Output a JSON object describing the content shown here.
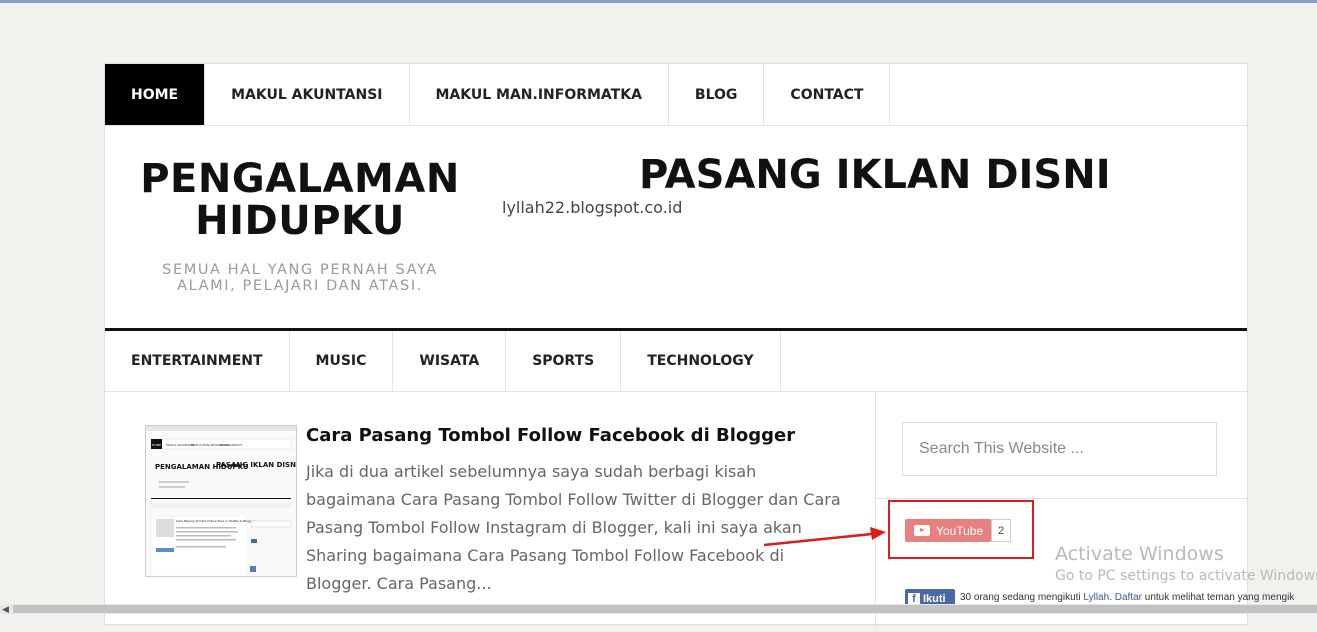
{
  "nav": {
    "items": [
      "HOME",
      "MAKUL AKUNTANSI",
      "MAKUL MAN.INFORMATKA",
      "BLOG",
      "CONTACT"
    ],
    "active": "HOME"
  },
  "header": {
    "site_title_line1": "PENGALAMAN",
    "site_title_line2": "HIDUPKU",
    "site_description": "SEMUA HAL YANG PERNAH SAYA ALAMI, PELAJARI DAN ATASI.",
    "ad_title": "PASANG IKLAN DISNI",
    "ad_url": "lyllah22.blogspot.co.id"
  },
  "categories": [
    "ENTERTAINMENT",
    "MUSIC",
    "WISATA",
    "SPORTS",
    "TECHNOLOGY"
  ],
  "post": {
    "title": "Cara Pasang Tombol Follow Facebook di Blogger",
    "excerpt": "Jika di dua artikel sebelumnya saya sudah berbagi kisah bagaimana Cara Pasang Tombol Follow Twitter di Blogger dan Cara Pasang Tombol Follow Instagram di Blogger, kali ini saya akan Sharing bagaimana Cara Pasang Tombol Follow Facebook di Blogger. Cara Pasang...",
    "thumbnail": {
      "nav_items": [
        "HOME",
        "MAKUL AKUNTANSI",
        "MAKUL MAN.INFORMATKA",
        "BLOG",
        "CONTACT"
      ],
      "site_title": "PENGALAMAN HIDUPKU",
      "ad_title": "PASANG IKLAN DISNI",
      "post_title": "Cara Pasang Tombol Follow Face in Twitter & Blogger"
    }
  },
  "sidebar": {
    "search_placeholder": "Search This Website ...",
    "youtube_label": "YouTube",
    "youtube_count": "2",
    "facebook_label": "Ikuti",
    "facebook_text_1": "30 orang sedang mengikuti ",
    "facebook_link_1": "Lyllah",
    "facebook_text_2": ". ",
    "facebook_link_2": "Daftar",
    "facebook_text_3": " untuk melihat teman yang mengik"
  },
  "overlay": {
    "activate_title": "Activate Windows",
    "activate_sub": "Go to PC settings to activate Windows."
  },
  "colors": {
    "accent_black": "#000000",
    "highlight_red": "#e01b1b",
    "youtube_red": "#e88080",
    "facebook_blue": "#4a67a8"
  }
}
